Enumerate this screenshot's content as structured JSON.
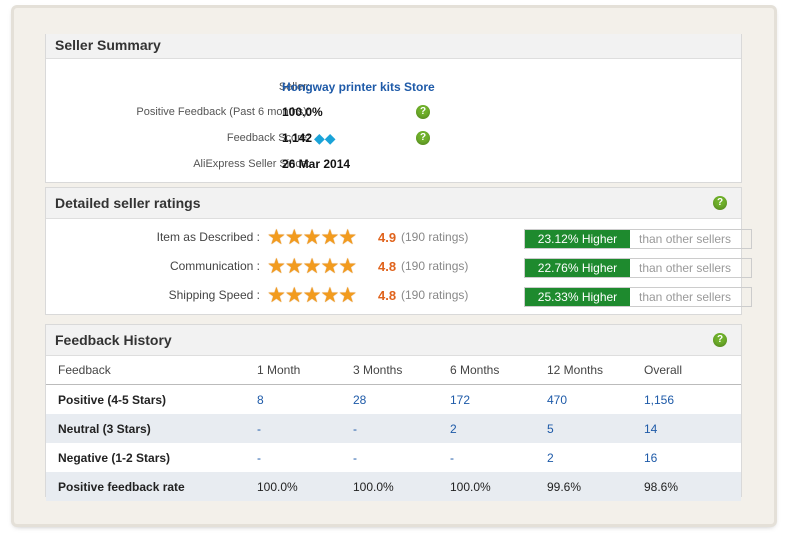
{
  "seller_summary": {
    "title": "Seller Summary",
    "seller_label": "Seller:",
    "seller_value": "Hongway printer kits Store",
    "positive_label": "Positive Feedback (Past 6 months):",
    "positive_value": "100.0%",
    "score_label": "Feedback Score:",
    "score_value": "1,142",
    "score_badge_icon": "diamond-icon",
    "since_label": "AliExpress Seller Since:",
    "since_value": "26 Mar 2014",
    "help_icon": "?"
  },
  "detailed_ratings": {
    "title": "Detailed seller ratings",
    "help_icon": "?",
    "stars_glyph": "★★★★★",
    "rows": [
      {
        "label": "Item as Described :",
        "score": "4.9",
        "count": "(190 ratings)",
        "compare": "23.12% Higher",
        "compare_suffix": "than other sellers"
      },
      {
        "label": "Communication :",
        "score": "4.8",
        "count": "(190 ratings)",
        "compare": "22.76% Higher",
        "compare_suffix": "than other sellers"
      },
      {
        "label": "Shipping Speed :",
        "score": "4.8",
        "count": "(190 ratings)",
        "compare": "25.33% Higher",
        "compare_suffix": "than other sellers"
      }
    ]
  },
  "feedback_history": {
    "title": "Feedback History",
    "help_icon": "?",
    "columns": [
      "Feedback",
      "1 Month",
      "3 Months",
      "6 Months",
      "12 Months",
      "Overall"
    ],
    "rows": [
      {
        "label": "Positive (4-5 Stars)",
        "values": [
          "8",
          "28",
          "172",
          "470",
          "1,156"
        ]
      },
      {
        "label": "Neutral (3 Stars)",
        "values": [
          "-",
          "-",
          "2",
          "5",
          "14"
        ]
      },
      {
        "label": "Negative (1-2 Stars)",
        "values": [
          "-",
          "-",
          "-",
          "2",
          "16"
        ]
      },
      {
        "label": "Positive feedback rate",
        "values": [
          "100.0%",
          "100.0%",
          "100.0%",
          "99.6%",
          "98.6%"
        ]
      }
    ]
  },
  "colors": {
    "link": "#1e5aa8",
    "score": "#e0631c",
    "compare_green": "#1e8a2e",
    "star": "#f29b1e",
    "help_green": "#6fb02a"
  }
}
